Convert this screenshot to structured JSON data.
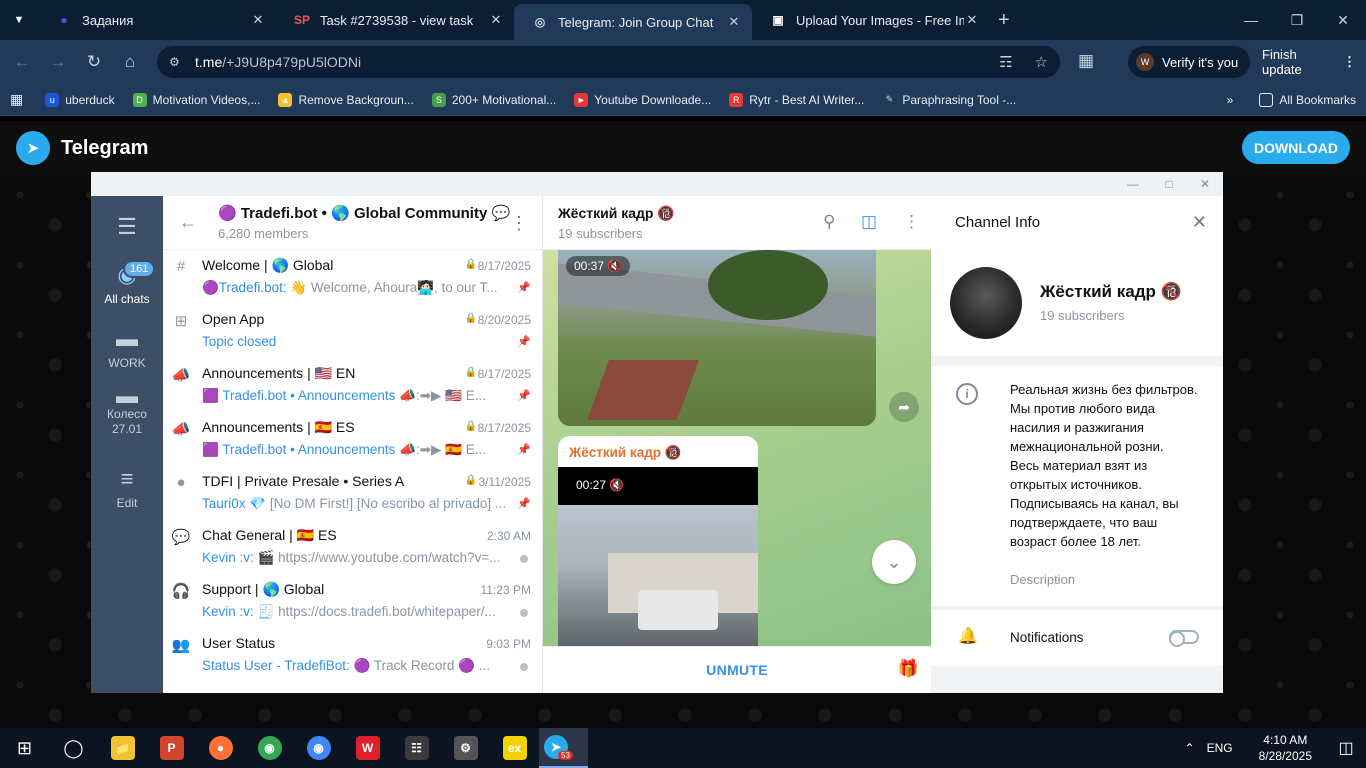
{
  "browser": {
    "tabs": [
      {
        "title": "Задания",
        "icon": "tab-favicon-zadaniya",
        "active": false
      },
      {
        "title": "Task #2739538 - view task",
        "icon": "tab-favicon-sp",
        "active": false
      },
      {
        "title": "Telegram: Join Group Chat",
        "icon": "tab-favicon-telegram",
        "active": true
      },
      {
        "title": "Upload Your Images - Free Imag",
        "icon": "tab-favicon-upload",
        "active": false
      }
    ],
    "url_host": "t.me",
    "url_path": "/+J9U8p479pU5lODNi",
    "verify_label": "Verify it's you",
    "verify_avatar": "W",
    "finish_update_label": "Finish update",
    "bookmarks": [
      {
        "label": "uberduck",
        "color": "#1a56db"
      },
      {
        "label": "Motivation Videos,...",
        "color": "#4caf50"
      },
      {
        "label": "Remove Backgroun...",
        "color": "#f2c230"
      },
      {
        "label": "200+ Motivational...",
        "color": "#43a047"
      },
      {
        "label": "Youtube Downloade...",
        "color": "#e53935"
      },
      {
        "label": "Rytr - Best AI Writer...",
        "color": "#e53935"
      },
      {
        "label": "Paraphrasing Tool -...",
        "color": "#dddddd"
      }
    ],
    "all_bookmarks_label": "All Bookmarks"
  },
  "telegram_site": {
    "brand": "Telegram",
    "download_label": "DOWNLOAD"
  },
  "folders": [
    {
      "label": "All chats",
      "badge": "161",
      "active": true
    },
    {
      "label": "WORK",
      "active": false
    },
    {
      "label": "Колесо 27.01",
      "active": false
    },
    {
      "label": "Edit",
      "active": false
    }
  ],
  "chatlist": {
    "title": "🟣 Tradefi.bot • 🌎 Global Community 💬",
    "members": "6,280 members",
    "topics": [
      {
        "icon": "#",
        "name": "Welcome | 🌎 Global",
        "date": "8/17/2025",
        "locked": true,
        "author": "🟣Tradefi.bot:",
        "preview": " 👋 Welcome, Ahoura🧑🏻‍💻, to our T...",
        "pinned": true
      },
      {
        "icon": "⊞",
        "name": "Open App",
        "date": "8/20/2025",
        "locked": true,
        "author": "Topic closed",
        "preview": "",
        "pinned": true
      },
      {
        "icon": "📣",
        "name": "Announcements | 🇺🇸 EN",
        "date": "8/17/2025",
        "locked": true,
        "author": "🟪 Tradefi.bot • Announcements",
        "preview": " 📣:➡▶ 🇺🇸 E...",
        "pinned": true
      },
      {
        "icon": "📣",
        "name": "Announcements | 🇪🇸 ES",
        "date": "8/17/2025",
        "locked": true,
        "author": "🟪 Tradefi.bot • Announcements",
        "preview": " 📣:➡▶ 🇪🇸 E...",
        "pinned": true
      },
      {
        "icon": "●",
        "name": "TDFI | Private Presale • Series A",
        "date": "3/11/2025",
        "locked": true,
        "author": "Tauri0x",
        "preview": " 💎 [No DM First!] [No escribo al privado] ...",
        "pinned": true
      },
      {
        "icon": "💬",
        "name": "Chat General | 🇪🇸 ES",
        "date": "2:30 AM",
        "locked": false,
        "author": "Kevin :v:",
        "preview": " 🎬 https://www.youtube.com/watch?v=...",
        "pinned": false
      },
      {
        "icon": "🎧",
        "name": "Support | 🌎 Global",
        "date": "11:23 PM",
        "locked": false,
        "author": "Kevin :v:",
        "preview": " 🧾 https://docs.tradefi.bot/whitepaper/...",
        "pinned": false
      },
      {
        "icon": "👥",
        "name": "User Status",
        "date": "9:03 PM",
        "locked": false,
        "author": "Status User - TradefiBot:",
        "preview": " 🟣 Track Record 🟣 ...",
        "pinned": false
      }
    ]
  },
  "channel": {
    "title": "Жёсткий кадр 🔞",
    "subscribers": "19 subscribers",
    "messages": [
      {
        "video_time": "00:37"
      },
      {
        "sender": "Жёсткий кадр 🔞",
        "video_time": "00:27"
      }
    ],
    "unmute_label": "UNMUTE"
  },
  "channel_info": {
    "header": "Channel Info",
    "name": "Жёсткий кадр 🔞",
    "subscribers": "19 subscribers",
    "description": "Реальная жизнь без фильтров.\nМы против любого вида насилия и разжигания межнациональной розни.\nВесь материал взят из открытых источников.\nПодписываясь на канал, вы подтверждаете, что ваш возраст более 18 лет.",
    "description_label": "Description",
    "notifications_label": "Notifications",
    "notifications_on": false
  },
  "taskbar": {
    "apps": [
      {
        "icon": "file-explorer-icon",
        "color": "#f2c230"
      },
      {
        "icon": "wps-presentation-icon",
        "color": "#d2452f"
      },
      {
        "icon": "firefox-icon",
        "color": "#ff7139"
      },
      {
        "icon": "chrome-profile-icon",
        "color": "#34a853"
      },
      {
        "icon": "chrome-icon",
        "color": "#4285f4"
      },
      {
        "icon": "wps-office-icon",
        "color": "#e0202a"
      },
      {
        "icon": "calculator-icon",
        "color": "#3a3a3a"
      },
      {
        "icon": "settings-icon",
        "color": "#555555"
      },
      {
        "icon": "exness-icon",
        "color": "#f2d300"
      },
      {
        "icon": "telegram-icon",
        "color": "#2aabee"
      }
    ],
    "telegram_badge": "53",
    "language": "ENG",
    "time": "4:10 AM",
    "date": "8/28/2025"
  }
}
